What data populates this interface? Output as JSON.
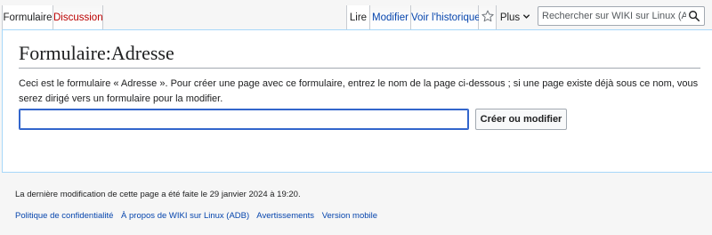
{
  "tabs": {
    "formulaire": "Formulaire",
    "discussion": "Discussion",
    "lire": "Lire",
    "modifier": "Modifier",
    "historique": "Voir l'historique",
    "plus": "Plus"
  },
  "search": {
    "placeholder": "Rechercher sur WIKI sur Linux (ADB)"
  },
  "main": {
    "title": "Formulaire:Adresse",
    "intro": "Ceci est le formulaire « Adresse  ». Pour créer une page avec ce formulaire, entrez le nom de la page ci-dessous ; si une page existe déjà sous ce nom, vous serez dirigé vers un formulaire pour la modifier.",
    "page_name_value": "",
    "create_button": "Créer ou modifier"
  },
  "footer": {
    "last_modified": "La dernière modification de cette page a été faite le 29 janvier 2024 à 19:20.",
    "links": [
      "Politique de confidentialité",
      "À propos de WIKI sur Linux (ADB)",
      "Avertissements",
      "Version mobile"
    ]
  },
  "colors": {
    "link": "#0645ad",
    "redlink": "#ba0000",
    "input_focus": "#3366cc"
  },
  "icons": {
    "watch": "star-icon",
    "more": "chevron-down-icon",
    "search": "search-icon"
  }
}
